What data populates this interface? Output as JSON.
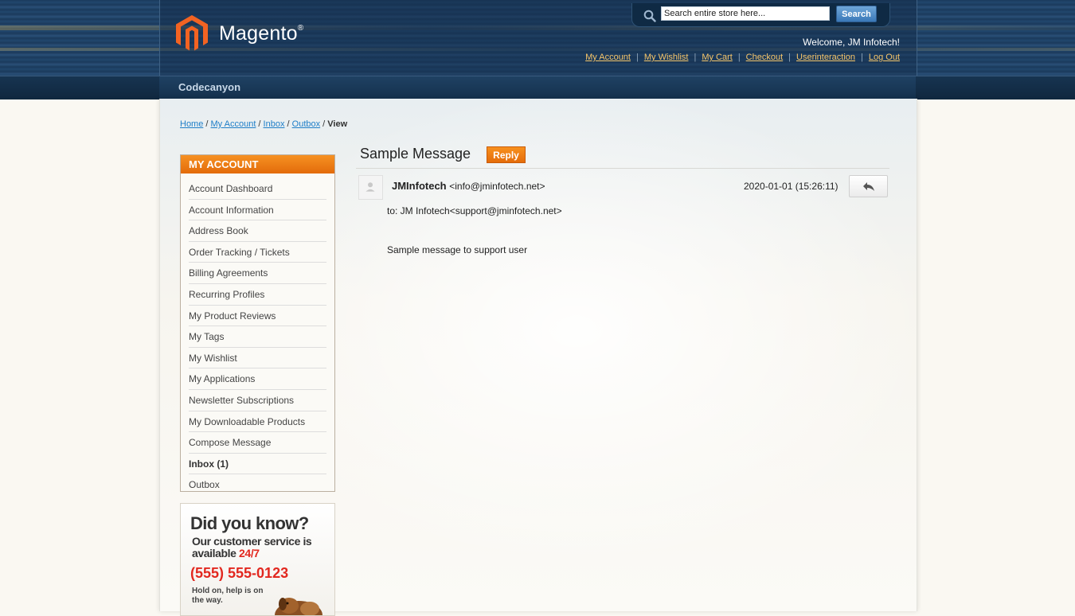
{
  "header": {
    "logo_text": "Magento",
    "logo_reg": "®",
    "search_placeholder": "Search entire store here...",
    "search_button": "Search",
    "welcome": "Welcome, JM Infotech!",
    "links": [
      "My Account",
      "My Wishlist",
      "My Cart",
      "Checkout",
      "Userinteraction",
      "Log Out"
    ],
    "nav_label": "Codecanyon"
  },
  "breadcrumb": {
    "items": [
      "Home",
      "My Account",
      "Inbox",
      "Outbox"
    ],
    "sep": " / ",
    "current": "View"
  },
  "sidebar": {
    "title": "MY ACCOUNT",
    "items": [
      "Account Dashboard",
      "Account Information",
      "Address Book",
      "Order Tracking / Tickets",
      "Billing Agreements",
      "Recurring Profiles",
      "My Product Reviews",
      "My Tags",
      "My Wishlist",
      "My Applications",
      "Newsletter Subscriptions",
      "My Downloadable Products",
      "Compose Message",
      "Inbox (1)",
      "Outbox"
    ],
    "active_index": 13
  },
  "ad": {
    "title": "Did you know?",
    "line1": "Our customer service is",
    "line2": "available ",
    "highlight": "24/7",
    "phone": "(555) 555-0123",
    "hold": "Hold on, help is on the way."
  },
  "message": {
    "title": "Sample Message",
    "reply_label": "Reply",
    "sender_name": "JMInfotech",
    "sender_email": "<info@jminfotech.net>",
    "date": "2020-01-01 (15:26:11)",
    "to": "to: JM Infotech<support@jminfotech.net>",
    "body": "Sample message to support user"
  },
  "colors": {
    "accent_orange": "#f18200",
    "link_blue": "#1e7ec8",
    "header_link_gold": "#f5c56a",
    "ad_red": "#e2281f"
  }
}
